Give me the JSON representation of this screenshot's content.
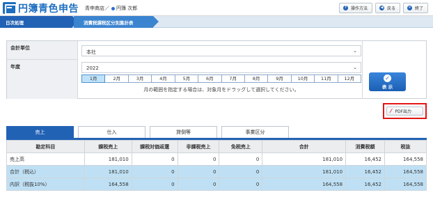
{
  "app": {
    "logo_text": "円簿青色申告"
  },
  "header": {
    "company": "青申商店／",
    "user": "円簿 次郎",
    "buttons": [
      {
        "icon": "?",
        "label": "操作方法"
      },
      {
        "icon": "◀",
        "label": "戻る"
      },
      {
        "icon": "✕",
        "label": "終了"
      }
    ]
  },
  "breadcrumb": [
    "日次処理",
    "消費税課税区分別集計表"
  ],
  "form": {
    "unit_label": "会計単位",
    "unit_value": "本社",
    "year_label": "年度",
    "year_value": "2022",
    "months": [
      "1月",
      "2月",
      "3月",
      "4月",
      "5月",
      "6月",
      "7月",
      "8月",
      "9月",
      "10月",
      "11月",
      "12月"
    ],
    "selected_month": "1月",
    "hint": "月の範囲を指定する場合は、対象月をドラッグして選択してください。",
    "show_label": "表 示"
  },
  "pdf_button": {
    "label": "PDF出力"
  },
  "tabs": [
    "売上",
    "仕入",
    "貸倒等",
    "事業区分"
  ],
  "active_tab": "売上",
  "table": {
    "columns": [
      "勘定科目",
      "課税売上",
      "課税対価返還",
      "非課税売上",
      "免税売上",
      "合計",
      "消費税額",
      "税抜"
    ],
    "rows": [
      [
        "売上高",
        "181,010",
        "0",
        "0",
        "0",
        "181,010",
        "16,452",
        "164,558"
      ],
      [
        "合計（税込）",
        "181,010",
        "0",
        "0",
        "0",
        "181,010",
        "16,452",
        "164,558"
      ],
      [
        "内訳（税抜10%）",
        "164,558",
        "0",
        "0",
        "0",
        "164,558",
        "16,452",
        "164,558"
      ]
    ]
  },
  "colors": {
    "primary": "#2262b5",
    "highlight_row": "#bfe0f4",
    "pdf_frame": "#e31414"
  }
}
